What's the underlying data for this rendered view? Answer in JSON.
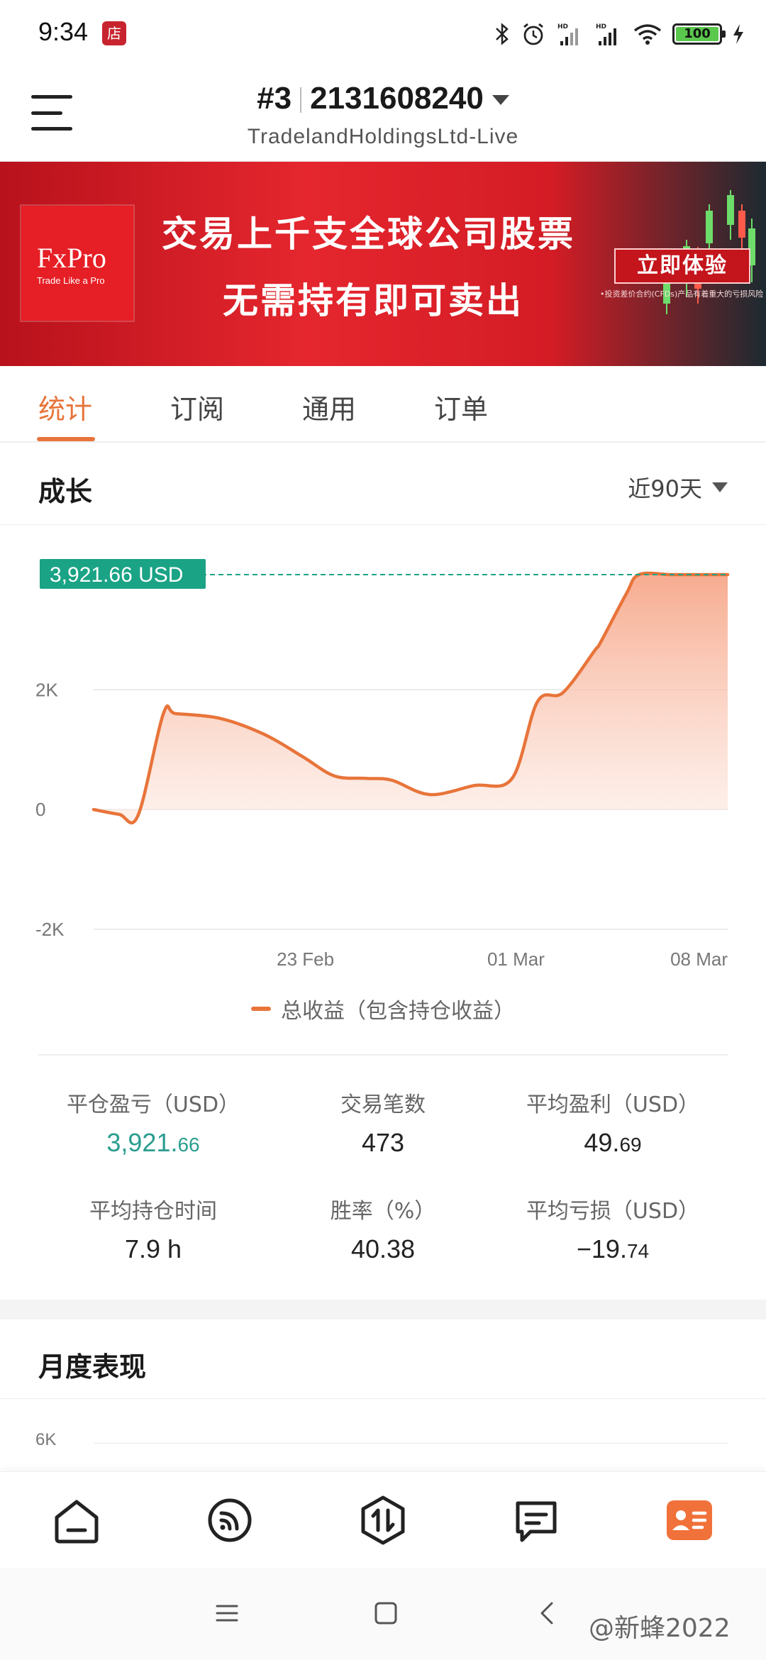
{
  "status_bar": {
    "time": "9:34",
    "app_badge": "店",
    "battery": "100"
  },
  "header": {
    "account_index": "#3",
    "account_number": "2131608240",
    "server": "TradelandHoldingsLtd-Live",
    "menu_icon": "hamburger-menu-icon"
  },
  "banner": {
    "logo_name": "FxPro",
    "logo_tagline": "Trade Like a Pro",
    "line1": "交易上千支全球公司股票",
    "line2": "无需持有即可卖出",
    "cta": "立即体验",
    "note": "•投资差价合约(CFDs)产品有着重大的亏损风险"
  },
  "tabs": [
    {
      "label": "统计",
      "active": true
    },
    {
      "label": "订阅",
      "active": false
    },
    {
      "label": "通用",
      "active": false
    },
    {
      "label": "订单",
      "active": false
    }
  ],
  "growth": {
    "title": "成长",
    "period": "近90天"
  },
  "chart_data": {
    "type": "area",
    "current_value_label": "3,921.66 USD",
    "y_ticks": [
      "2K",
      "0",
      "-2K"
    ],
    "y_tick_values": [
      2000,
      0,
      -2000
    ],
    "ylim": [
      -2000,
      3921.66
    ],
    "x_tick_labels": [
      "23 Feb",
      "01 Mar",
      "08 Mar"
    ],
    "x_tick_positions": [
      0.334,
      0.666,
      1.0
    ],
    "x": [
      0,
      0.04,
      0.07,
      0.11,
      0.13,
      0.2,
      0.27,
      0.33,
      0.38,
      0.43,
      0.47,
      0.53,
      0.6,
      0.66,
      0.7,
      0.74,
      0.79,
      0.8,
      0.84,
      0.86,
      0.91,
      0.94,
      0.98,
      1.0
    ],
    "y": [
      0,
      -80,
      -100,
      1600,
      1600,
      1520,
      1250,
      880,
      560,
      520,
      490,
      250,
      400,
      520,
      1800,
      1950,
      2650,
      2800,
      3600,
      3921.66,
      3921.66,
      3921.66,
      3921.66,
      3921.66
    ],
    "series": [
      {
        "name": "总收益（包含持仓收益）",
        "color": "#e8743a"
      }
    ],
    "colors": {
      "line": "#e8743a",
      "fill_top": "#f6a283",
      "fill_bottom": "#fde9e1",
      "marker": "#1aa385"
    }
  },
  "legend": {
    "label": "总收益（包含持仓收益）"
  },
  "stats": [
    {
      "label": "平仓盈亏（USD）",
      "int": "3,921.",
      "frac": "66",
      "green": true
    },
    {
      "label": "交易笔数",
      "int": "473",
      "frac": "",
      "green": false
    },
    {
      "label": "平均盈利（USD）",
      "int": "49.",
      "frac": "69",
      "green": false
    },
    {
      "label": "平均持仓时间",
      "int": "7.9 h",
      "frac": "",
      "green": false
    },
    {
      "label": "胜率（%）",
      "int": "40.38",
      "frac": "",
      "green": false
    },
    {
      "label": "平均亏损（USD）",
      "int": "−19.",
      "frac": "74",
      "green": false
    }
  ],
  "monthly": {
    "title": "月度表现",
    "first_tick": "6K"
  },
  "bottom_nav": [
    {
      "name": "home-icon",
      "active": false
    },
    {
      "name": "signal-feed-icon",
      "active": false
    },
    {
      "name": "trade-exchange-icon",
      "active": false
    },
    {
      "name": "messages-icon",
      "active": false
    },
    {
      "name": "account-card-icon",
      "active": true
    }
  ],
  "system_nav": {
    "watermark": "@新蜂2022"
  }
}
